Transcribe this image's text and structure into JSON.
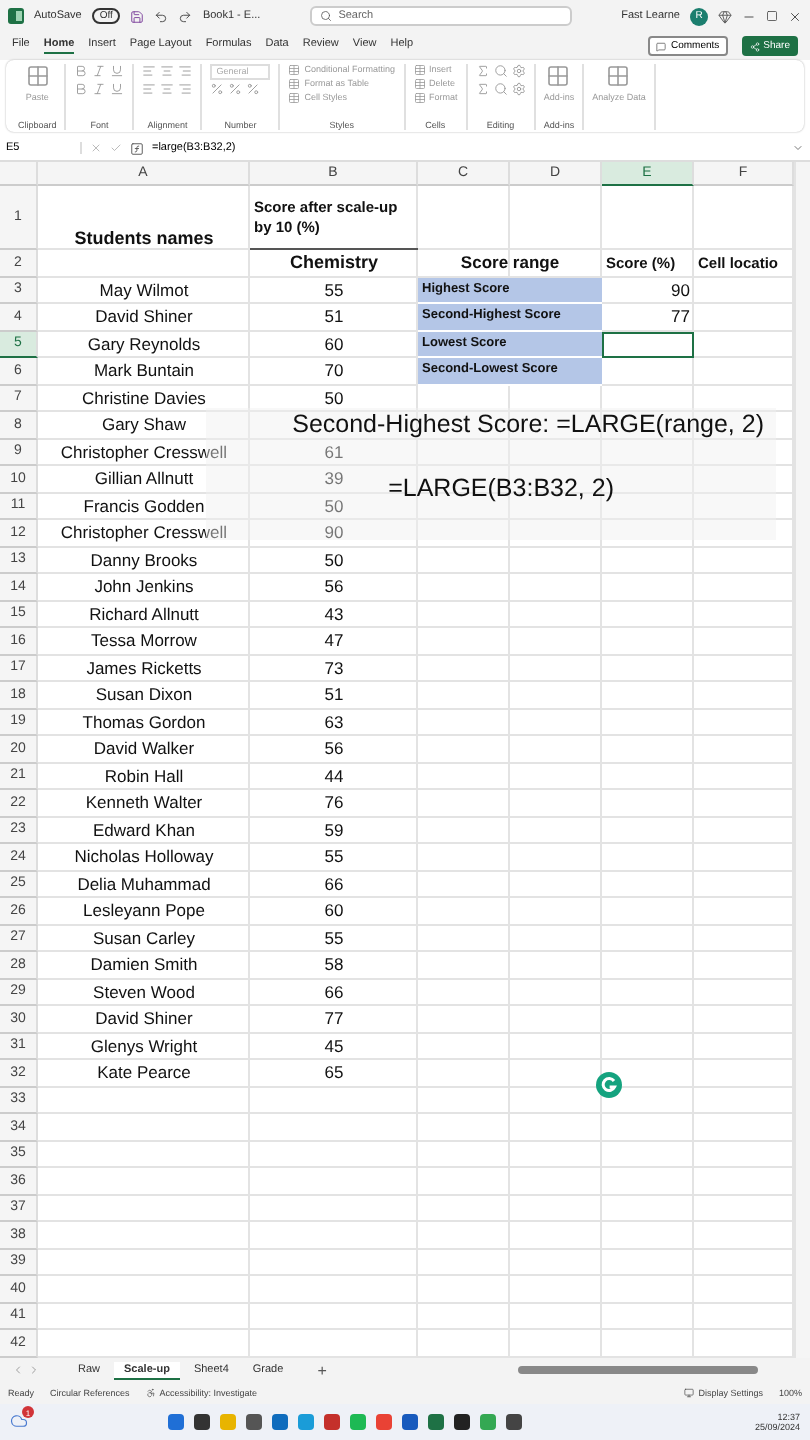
{
  "title_bar": {
    "autosave_label": "AutoSave",
    "autosave_state": "Off",
    "document": "Book1 - E...",
    "search_placeholder": "Search",
    "user": "Fast Learne",
    "avatar": "R"
  },
  "menu": [
    {
      "label": "File",
      "selected": false
    },
    {
      "label": "Home",
      "selected": true
    },
    {
      "label": "Insert",
      "selected": false
    },
    {
      "label": "Page Layout",
      "selected": false
    },
    {
      "label": "Formulas",
      "selected": false
    },
    {
      "label": "Data",
      "selected": false
    },
    {
      "label": "Review",
      "selected": false
    },
    {
      "label": "View",
      "selected": false
    },
    {
      "label": "Help",
      "selected": false
    }
  ],
  "comments_button": "Comments",
  "share_button": "Share",
  "ribbon": [
    {
      "label": "Clipboard",
      "kind": "large",
      "buttons": [
        "Paste"
      ]
    },
    {
      "label": "Font",
      "kind": "icons"
    },
    {
      "label": "Alignment",
      "kind": "icons"
    },
    {
      "label": "Number",
      "kind": "field",
      "buttons": [
        "General"
      ]
    },
    {
      "label": "Styles",
      "kind": "list",
      "buttons": [
        "Conditional Formatting",
        "Format as Table",
        "Cell Styles"
      ]
    },
    {
      "label": "Cells",
      "kind": "list",
      "buttons": [
        "Insert",
        "Delete",
        "Format"
      ]
    },
    {
      "label": "Editing",
      "kind": "icons"
    },
    {
      "label": "Add-ins",
      "kind": "large",
      "buttons": [
        "Add-ins"
      ]
    },
    {
      "kind": "large",
      "buttons": [
        "Analyze Data"
      ]
    }
  ],
  "formula_bar": {
    "name_box": "E5",
    "formula": "=large(B3:B32,2)"
  },
  "columns": [
    {
      "label": "A",
      "selected": false
    },
    {
      "label": "B",
      "selected": false
    },
    {
      "label": "C",
      "selected": false
    },
    {
      "label": "D",
      "selected": false
    },
    {
      "label": "E",
      "selected": true
    },
    {
      "label": "F",
      "selected": false
    }
  ],
  "rows": [
    {
      "number": "1",
      "kind": "title",
      "selected": false,
      "a": "Students names",
      "b": "Score after scale-up by 10 (%)"
    },
    {
      "number": "2",
      "kind": "subheader",
      "selected": false,
      "b": "Chemistry",
      "c": "Score range",
      "e": "Score (%)",
      "f": "Cell locatio"
    },
    {
      "number": "3",
      "kind": "metric",
      "selected": false,
      "a": "May Wilmot",
      "b": "55",
      "c": "Highest Score",
      "e": "90"
    },
    {
      "number": "4",
      "kind": "metric",
      "selected": false,
      "a": "David Shiner",
      "b": "51",
      "c": "Second-Highest Score",
      "e": "77"
    },
    {
      "number": "5",
      "kind": "metric",
      "selected": true,
      "a": "Gary Reynolds",
      "b": "60",
      "c": "Lowest Score"
    },
    {
      "number": "6",
      "kind": "metric",
      "selected": false,
      "a": "Mark Buntain",
      "b": "70",
      "c": "Second-Lowest Score"
    },
    {
      "number": "7",
      "kind": "data",
      "selected": false,
      "a": "Christine Davies",
      "b": "50"
    },
    {
      "number": "8",
      "kind": "data",
      "selected": false,
      "a": "Gary Shaw"
    },
    {
      "number": "9",
      "kind": "data",
      "selected": false,
      "a": "Christopher Cresswell",
      "b": "61"
    },
    {
      "number": "10",
      "kind": "data",
      "selected": false,
      "a": "Gillian Allnutt",
      "b": "39"
    },
    {
      "number": "11",
      "kind": "data",
      "selected": false,
      "a": "Francis Godden",
      "b": "50"
    },
    {
      "number": "12",
      "kind": "data",
      "selected": false,
      "a": "Christopher Cresswell",
      "b": "90"
    },
    {
      "number": "13",
      "kind": "data",
      "selected": false,
      "a": "Danny Brooks",
      "b": "50"
    },
    {
      "number": "14",
      "kind": "data",
      "selected": false,
      "a": "John Jenkins",
      "b": "56"
    },
    {
      "number": "15",
      "kind": "data",
      "selected": false,
      "a": "Richard Allnutt",
      "b": "43"
    },
    {
      "number": "16",
      "kind": "data",
      "selected": false,
      "a": "Tessa Morrow",
      "b": "47"
    },
    {
      "number": "17",
      "kind": "data",
      "selected": false,
      "a": "James Ricketts",
      "b": "73"
    },
    {
      "number": "18",
      "kind": "data",
      "selected": false,
      "a": "Susan Dixon",
      "b": "51"
    },
    {
      "number": "19",
      "kind": "data",
      "selected": false,
      "a": "Thomas Gordon",
      "b": "63"
    },
    {
      "number": "20",
      "kind": "data",
      "selected": false,
      "a": "David Walker",
      "b": "56"
    },
    {
      "number": "21",
      "kind": "data",
      "selected": false,
      "a": "Robin Hall",
      "b": "44"
    },
    {
      "number": "22",
      "kind": "data",
      "selected": false,
      "a": "Kenneth Walter",
      "b": "76"
    },
    {
      "number": "23",
      "kind": "data",
      "selected": false,
      "a": "Edward Khan",
      "b": "59"
    },
    {
      "number": "24",
      "kind": "data",
      "selected": false,
      "a": "Nicholas Holloway",
      "b": "55"
    },
    {
      "number": "25",
      "kind": "data",
      "selected": false,
      "a": "Delia Muhammad",
      "b": "66"
    },
    {
      "number": "26",
      "kind": "data",
      "selected": false,
      "a": "Lesleyann Pope",
      "b": "60"
    },
    {
      "number": "27",
      "kind": "data",
      "selected": false,
      "a": "Susan Carley",
      "b": "55"
    },
    {
      "number": "28",
      "kind": "data",
      "selected": false,
      "a": "Damien Smith",
      "b": "58"
    },
    {
      "number": "29",
      "kind": "data",
      "selected": false,
      "a": "Steven Wood",
      "b": "66"
    },
    {
      "number": "30",
      "kind": "data",
      "selected": false,
      "a": "David Shiner",
      "b": "77"
    },
    {
      "number": "31",
      "kind": "data",
      "selected": false,
      "a": "Glenys Wright",
      "b": "45"
    },
    {
      "number": "32",
      "kind": "data",
      "selected": false,
      "a": "Kate Pearce",
      "b": "65"
    },
    {
      "number": "33",
      "kind": "data",
      "selected": false
    },
    {
      "number": "34",
      "kind": "data",
      "selected": false
    },
    {
      "number": "35",
      "kind": "data",
      "selected": false
    },
    {
      "number": "36",
      "kind": "data",
      "selected": false
    },
    {
      "number": "37",
      "kind": "data",
      "selected": false
    },
    {
      "number": "38",
      "kind": "data",
      "selected": false
    },
    {
      "number": "39",
      "kind": "data",
      "selected": false
    },
    {
      "number": "40",
      "kind": "data",
      "selected": false
    },
    {
      "number": "41",
      "kind": "data",
      "selected": false
    },
    {
      "number": "42",
      "kind": "data",
      "selected": false
    }
  ],
  "overlay": {
    "title": "Second-Highest Score: =LARGE(range, 2)",
    "formula": "=LARGE(B3:B32, 2)"
  },
  "sheet_tabs": [
    {
      "label": "Raw",
      "selected": false
    },
    {
      "label": "Scale-up",
      "selected": true
    },
    {
      "label": "Sheet4",
      "selected": false
    },
    {
      "label": "Grade",
      "selected": false
    }
  ],
  "add_sheet": "+",
  "status_bar": {
    "items": [
      "Ready",
      "Circular References"
    ],
    "accessibility": "Accessibility: Investigate",
    "display": "Display Settings",
    "zoom": "100%"
  },
  "taskbar": {
    "badge": "1",
    "time": "12:37",
    "date": "25/09/2024"
  }
}
